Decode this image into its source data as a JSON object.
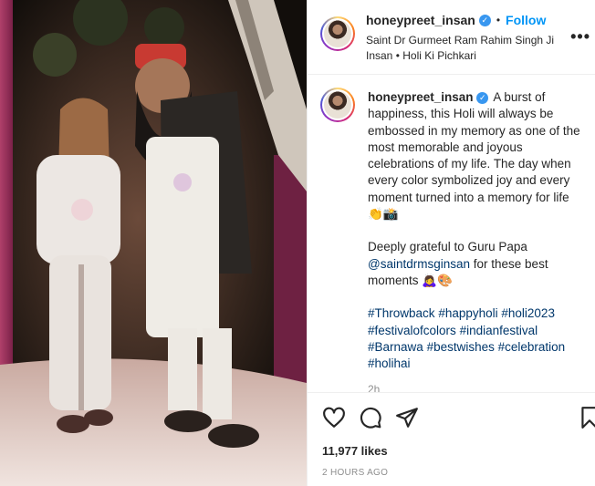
{
  "post": {
    "username": "honeypreet_insan",
    "verified_glyph": "✓",
    "separator": "•",
    "follow_label": "Follow",
    "location": "Saint Dr Gurmeet Ram Rahim Singh Ji Insan • Holi Ki Pichkari",
    "more_label": "•••"
  },
  "caption": {
    "username": "honeypreet_insan",
    "text_1": " A burst of happiness, this Holi will always be embossed in my memory as one of the most memorable and joyous celebrations of my life. The day when every color symbolized joy and every moment turned into a memory for life 👏📸",
    "text_2_prefix": "Deeply grateful to Guru Papa ",
    "mention": "@saintdrmsginsan",
    "text_2_suffix": " for these best moments 🙇‍♀️🎨",
    "hashtags": [
      "#Throwback",
      "#happyholi",
      "#holi2023",
      "#festivalofcolors",
      "#indianfestival",
      "#Barnawa",
      "#bestwishes",
      "#celebration",
      "#holihai"
    ],
    "time_ago": "2h"
  },
  "actions": {
    "icons": [
      "heart-icon",
      "comment-icon",
      "share-icon",
      "bookmark-icon"
    ],
    "likes": "11,977 likes",
    "posted": "2 HOURS AGO"
  },
  "colors": {
    "follow": "#0095f6",
    "verified": "#3897f0",
    "link": "#00376b",
    "muted": "#8e8e8e"
  }
}
